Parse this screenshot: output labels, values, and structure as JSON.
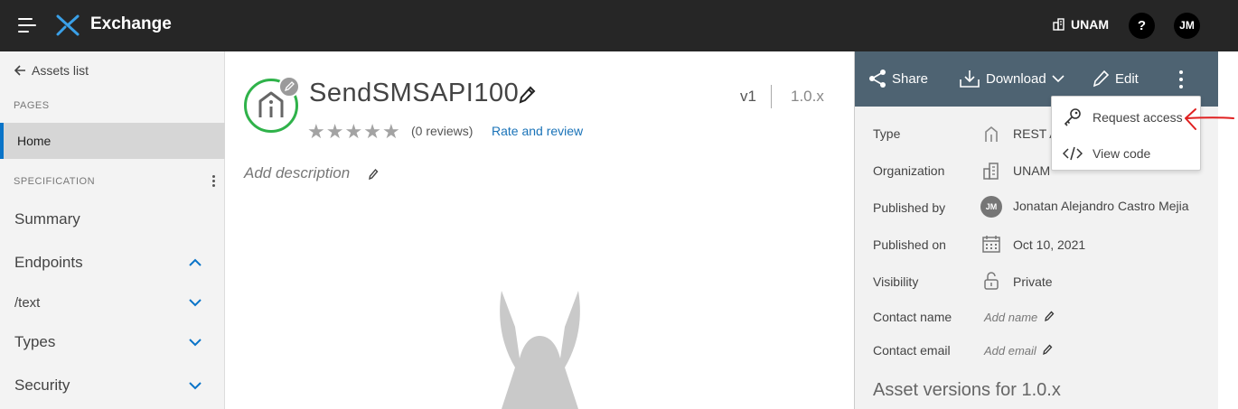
{
  "topbar": {
    "app_name": "Exchange",
    "org_name": "UNAM",
    "help_label": "?",
    "user_initials": "JM"
  },
  "sidebar": {
    "back_label": "Assets list",
    "pages_label": "PAGES",
    "home_label": "Home",
    "spec_label": "SPECIFICATION",
    "items": [
      {
        "label": "Summary",
        "chevron": "none"
      },
      {
        "label": "Endpoints",
        "chevron": "up"
      },
      {
        "label": "/text",
        "chevron": "down"
      },
      {
        "label": "Types",
        "chevron": "down"
      },
      {
        "label": "Security",
        "chevron": "down"
      }
    ]
  },
  "asset": {
    "title": "SendSMSAPI100",
    "reviews": "(0 reviews)",
    "rate_link": "Rate and review",
    "version": "v1",
    "version_range": "1.0.x",
    "add_description": "Add description",
    "rating": 0,
    "stars_total": 5
  },
  "actions": {
    "share": "Share",
    "download": "Download",
    "edit": "Edit"
  },
  "meta": {
    "type_label": "Type",
    "type_value": "REST A",
    "org_label": "Organization",
    "org_value": "UNAM",
    "published_by_label": "Published by",
    "published_by_initials": "JM",
    "published_by_value": "Jonatan Alejandro Castro Mejia",
    "published_on_label": "Published on",
    "published_on_value": "Oct 10, 2021",
    "visibility_label": "Visibility",
    "visibility_value": "Private",
    "contact_name_label": "Contact name",
    "contact_name_value": "Add name",
    "contact_email_label": "Contact email",
    "contact_email_value": "Add email"
  },
  "versions_heading": "Asset versions for 1.0.x",
  "dropdown": {
    "request_access": "Request access",
    "view_code": "View code"
  },
  "colors": {
    "topbar": "#262626",
    "accent_blue": "#0a74c8",
    "action_bar": "#4e6372",
    "asset_ring": "#2fb24a",
    "link": "#1a73b8",
    "annotation_red": "#e02020"
  }
}
